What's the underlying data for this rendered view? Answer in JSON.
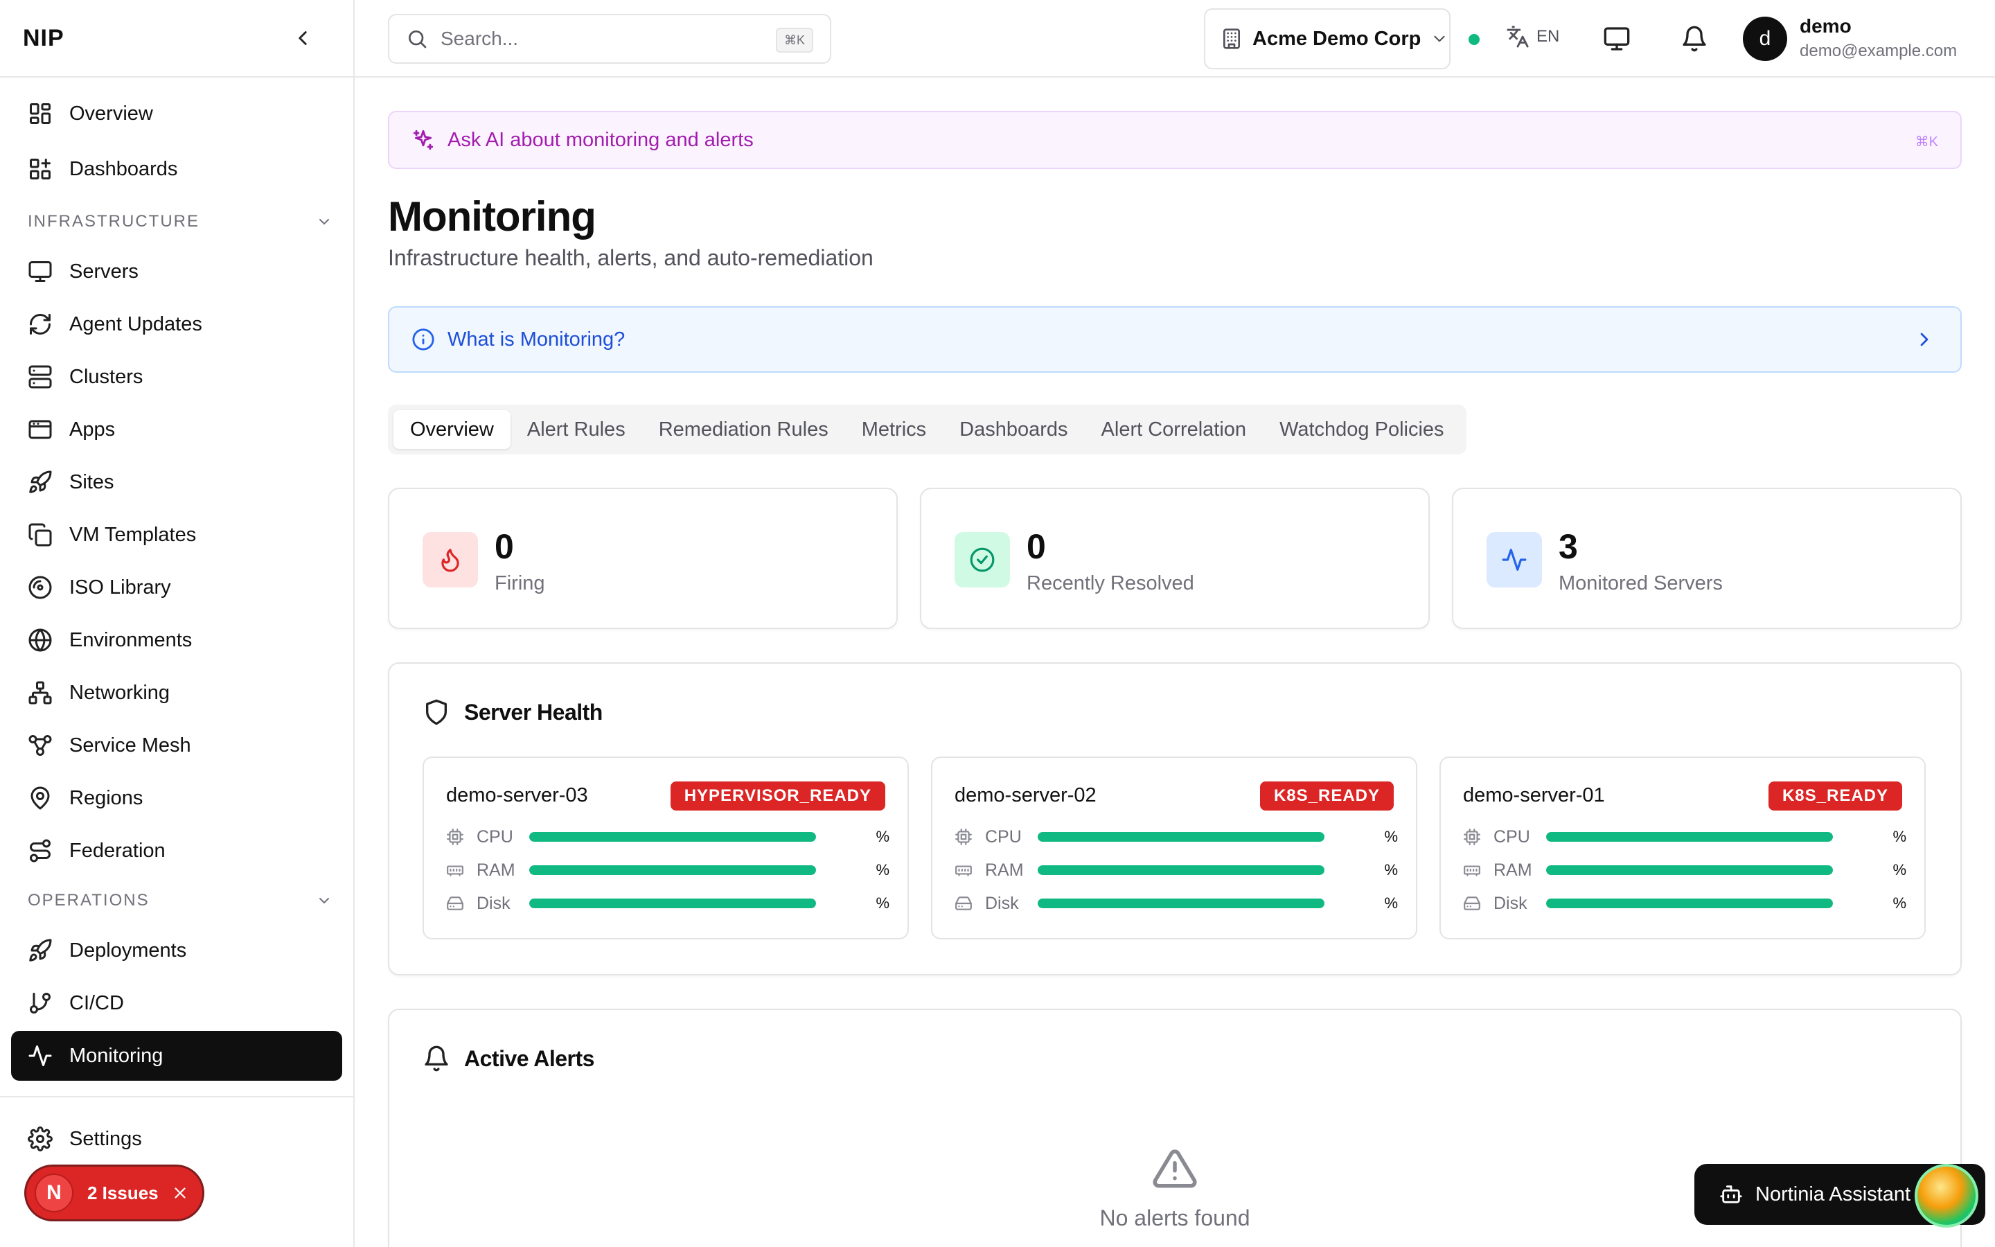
{
  "sidebar": {
    "brand": "NIP",
    "top_items": [
      {
        "label": "Overview",
        "icon": "layout-grid-icon"
      },
      {
        "label": "Dashboards",
        "icon": "dashboard-icon"
      }
    ],
    "sections": [
      {
        "title": "INFRASTRUCTURE",
        "items": [
          {
            "label": "Servers",
            "icon": "monitor-icon"
          },
          {
            "label": "Agent Updates",
            "icon": "refresh-icon"
          },
          {
            "label": "Clusters",
            "icon": "server-icon"
          },
          {
            "label": "Apps",
            "icon": "app-window-icon"
          },
          {
            "label": "Sites",
            "icon": "rocket-icon"
          },
          {
            "label": "VM Templates",
            "icon": "copy-icon"
          },
          {
            "label": "ISO Library",
            "icon": "disc-icon"
          },
          {
            "label": "Environments",
            "icon": "globe-icon"
          },
          {
            "label": "Networking",
            "icon": "network-icon"
          },
          {
            "label": "Service Mesh",
            "icon": "workflow-icon"
          },
          {
            "label": "Regions",
            "icon": "map-pin-icon"
          },
          {
            "label": "Federation",
            "icon": "route-icon"
          }
        ]
      },
      {
        "title": "OPERATIONS",
        "items": [
          {
            "label": "Deployments",
            "icon": "rocket-icon"
          },
          {
            "label": "CI/CD",
            "icon": "git-branch-icon"
          },
          {
            "label": "Monitoring",
            "icon": "activity-icon",
            "active": true
          }
        ]
      }
    ],
    "settings_label": "Settings",
    "issues_badge": {
      "logo": "N",
      "label": "2 Issues"
    }
  },
  "topbar": {
    "search_placeholder": "Search...",
    "search_shortcut": "⌘K",
    "org_name": "Acme Demo Corp",
    "language": "EN",
    "user": {
      "initial": "d",
      "name": "demo",
      "email": "demo@example.com"
    }
  },
  "ai_banner": {
    "text": "Ask AI about monitoring and alerts",
    "shortcut": "⌘K"
  },
  "page": {
    "title": "Monitoring",
    "subtitle": "Infrastructure health, alerts, and auto-remediation"
  },
  "info_banner": {
    "text": "What is Monitoring?"
  },
  "tabs": [
    "Overview",
    "Alert Rules",
    "Remediation Rules",
    "Metrics",
    "Dashboards",
    "Alert Correlation",
    "Watchdog Policies"
  ],
  "active_tab": "Overview",
  "stats": [
    {
      "value": "0",
      "label": "Firing",
      "icon": "flame-icon",
      "color": "#dc2626",
      "bg": "#fee2e2"
    },
    {
      "value": "0",
      "label": "Recently Resolved",
      "icon": "check-circle-icon",
      "color": "#059669",
      "bg": "#d1fae5"
    },
    {
      "value": "3",
      "label": "Monitored Servers",
      "icon": "activity-icon",
      "color": "#2563eb",
      "bg": "#dbeafe"
    }
  ],
  "server_health": {
    "title": "Server Health",
    "servers": [
      {
        "name": "demo-server-03",
        "status": "HYPERVISOR_READY",
        "metrics": [
          {
            "label": "CPU",
            "pct": "%",
            "fill": 1
          },
          {
            "label": "RAM",
            "pct": "%",
            "fill": 1
          },
          {
            "label": "Disk",
            "pct": "%",
            "fill": 1
          }
        ]
      },
      {
        "name": "demo-server-02",
        "status": "K8S_READY",
        "metrics": [
          {
            "label": "CPU",
            "pct": "%",
            "fill": 1
          },
          {
            "label": "RAM",
            "pct": "%",
            "fill": 1
          },
          {
            "label": "Disk",
            "pct": "%",
            "fill": 1
          }
        ]
      },
      {
        "name": "demo-server-01",
        "status": "K8S_READY",
        "metrics": [
          {
            "label": "CPU",
            "pct": "%",
            "fill": 1
          },
          {
            "label": "RAM",
            "pct": "%",
            "fill": 1
          },
          {
            "label": "Disk",
            "pct": "%",
            "fill": 1
          }
        ]
      }
    ]
  },
  "active_alerts": {
    "title": "Active Alerts",
    "empty_text": "No alerts found"
  },
  "assistant": {
    "label": "Nortinia Assistant"
  },
  "colors": {
    "accent": "#0f0f10",
    "bar": "#10b981",
    "badge": "#dc2626",
    "ai": "#a21caf",
    "info": "#1d4ed8"
  }
}
